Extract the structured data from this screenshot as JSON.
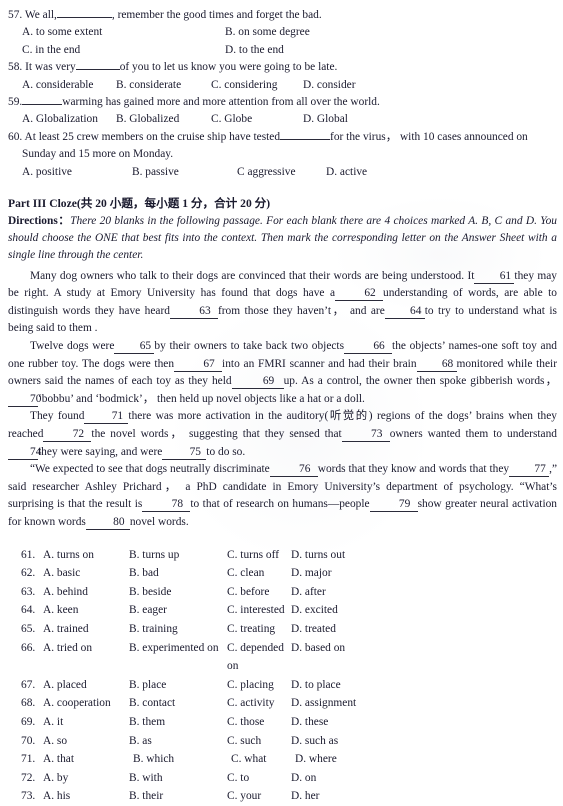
{
  "document": {
    "title": "English Exam Paper - Cloze Section"
  },
  "mcq_section": {
    "questions": [
      {
        "number": "57.",
        "stem_before": "We all,",
        "stem_after": ", remember the good times and forget the bad.",
        "layout": "two-col",
        "options": [
          "A. to some extent",
          "B. on some degree",
          "C. in the end",
          "D. to the end"
        ]
      },
      {
        "number": "58.",
        "stem_before": "It was very",
        "stem_after": "of you to let us know you were going to be late.",
        "layout": "four-col",
        "options": [
          "A. considerable",
          "B. considerate",
          "C. considering",
          "D. consider"
        ]
      },
      {
        "number": "59.",
        "stem_before": "",
        "stem_after": "warming has gained more and more attention from all over the world.",
        "layout": "four-col",
        "options": [
          "A. Globalization",
          "B. Globalized",
          "C. Globe",
          "D. Global"
        ]
      },
      {
        "number": "60.",
        "stem_before": "At least 25 crew members on the cruise ship have tested",
        "stem_after": "for the virus， with 10 cases announced on",
        "stem_line2": "Sunday and 15 more on Monday.",
        "layout": "wide-col",
        "options": [
          "A. positive",
          "B. passive",
          "C aggressive",
          "D. active"
        ]
      }
    ]
  },
  "part3": {
    "heading": "Part III Cloze(共 20 小题，每小题 1 分，合计 20 分)",
    "directions_label": "Directions：",
    "directions_text": "There 20 blanks in the following passage. For each blank there are 4 choices marked A. B, C and D. You should choose the ONE that best fits into the context. Then mark the corresponding letter on the Answer Sheet with a single line through the center.",
    "passage": {
      "p1": {
        "s1": "Many dog owners who talk to their dogs are convinced that their words are being understood. It",
        "b1": "61",
        "s2": "they may be right. A study at Emory University has found that dogs have a",
        "b2": "62",
        "s3": "understanding of words, are able to distinguish words they have heard",
        "b3": "63",
        "s4": "from those they haven’t， and are",
        "b4": "64",
        "s5": "to try to understand what is being said to them ."
      },
      "p2": {
        "s1": "Twelve dogs were",
        "b1": "65",
        "s2": "by their owners to take back two objects",
        "b2": "66",
        "s3": "the objects’ names-one soft toy and one rubber toy. The dogs were then",
        "b3": "67",
        "s4": "into an FMRI scanner and had their brain",
        "b4": "68",
        "s5": "monitored while their owners said the names of each toy as they held",
        "b5": "69",
        "s6": "up. As a control, the owner then spoke gibberish words，",
        "b6": "70",
        "s7": "‘bobbu’ and ‘bodmick’， then held up novel objects like a hat or a doll."
      },
      "p3": {
        "s1": "They found",
        "b1": "71",
        "s2": "there was more activation in the auditory(听觉的) regions of the dogs’ brains when they reached",
        "b2": "72",
        "s3": "the novel words， suggesting that they sensed that",
        "b3": "73",
        "s4": "owners wanted them to understand",
        "b4": "74",
        "s5": "they were saying, and were",
        "b5": "75",
        "s6": "to do so."
      },
      "p4": {
        "s1": "“We expected to see that dogs neutrally discriminate",
        "b1": "76",
        "s2": "words that they know and words that they",
        "b2": "77",
        "s3": ",” said researcher Ashley Prichard， a PhD candidate in Emory University’s department of psychology. “What’s surprising is that the result is",
        "b3": "78",
        "s4": "to that of research on humans—people",
        "b4": "79",
        "s5": "show greater neural activation for known words",
        "b5": "80",
        "s6": "novel words."
      }
    }
  },
  "choices": {
    "rows": [
      {
        "num": "61.",
        "a": "A. turns on",
        "b": "B. turns up",
        "c": "C. turns off",
        "d": "D. turns out"
      },
      {
        "num": "62.",
        "a": "A. basic",
        "b": "B. bad",
        "c": "C. clean",
        "d": "D. major"
      },
      {
        "num": "63.",
        "a": "A. behind",
        "b": "B. beside",
        "c": "C. before",
        "d": "D. after"
      },
      {
        "num": "64.",
        "a": "A. keen",
        "b": "B. eager",
        "c": "C. interested",
        "d": "D. excited"
      },
      {
        "num": "65.",
        "a": "A. trained",
        "b": "B. training",
        "c": "C. treating",
        "d": "D. treated"
      },
      {
        "num": "66.",
        "a": "A. tried on",
        "b": "B. experimented on",
        "c": "C. depended on",
        "d": "D. based on"
      },
      {
        "num": "67.",
        "a": "A. placed",
        "b": "B. place",
        "c": "C. placing",
        "d": "D. to place"
      },
      {
        "num": "68.",
        "a": "A. cooperation",
        "b": "B. contact",
        "c": "C. activity",
        "d": "D. assignment"
      },
      {
        "num": "69.",
        "a": "A. it",
        "b": "B. them",
        "c": "C. those",
        "d": "D. these"
      },
      {
        "num": "70.",
        "a": "A. so",
        "b": "B. as",
        "c": "C. such",
        "d": "D. such as"
      },
      {
        "num": "71.",
        "a": "A. that",
        "b": "B. which",
        "c": "C. what",
        "d": "D. where"
      },
      {
        "num": "72.",
        "a": "A. by",
        "b": "B. with",
        "c": "C. to",
        "d": "D. on"
      },
      {
        "num": "73.",
        "a": "A. his",
        "b": "B. their",
        "c": "C. your",
        "d": "D. her"
      }
    ]
  }
}
